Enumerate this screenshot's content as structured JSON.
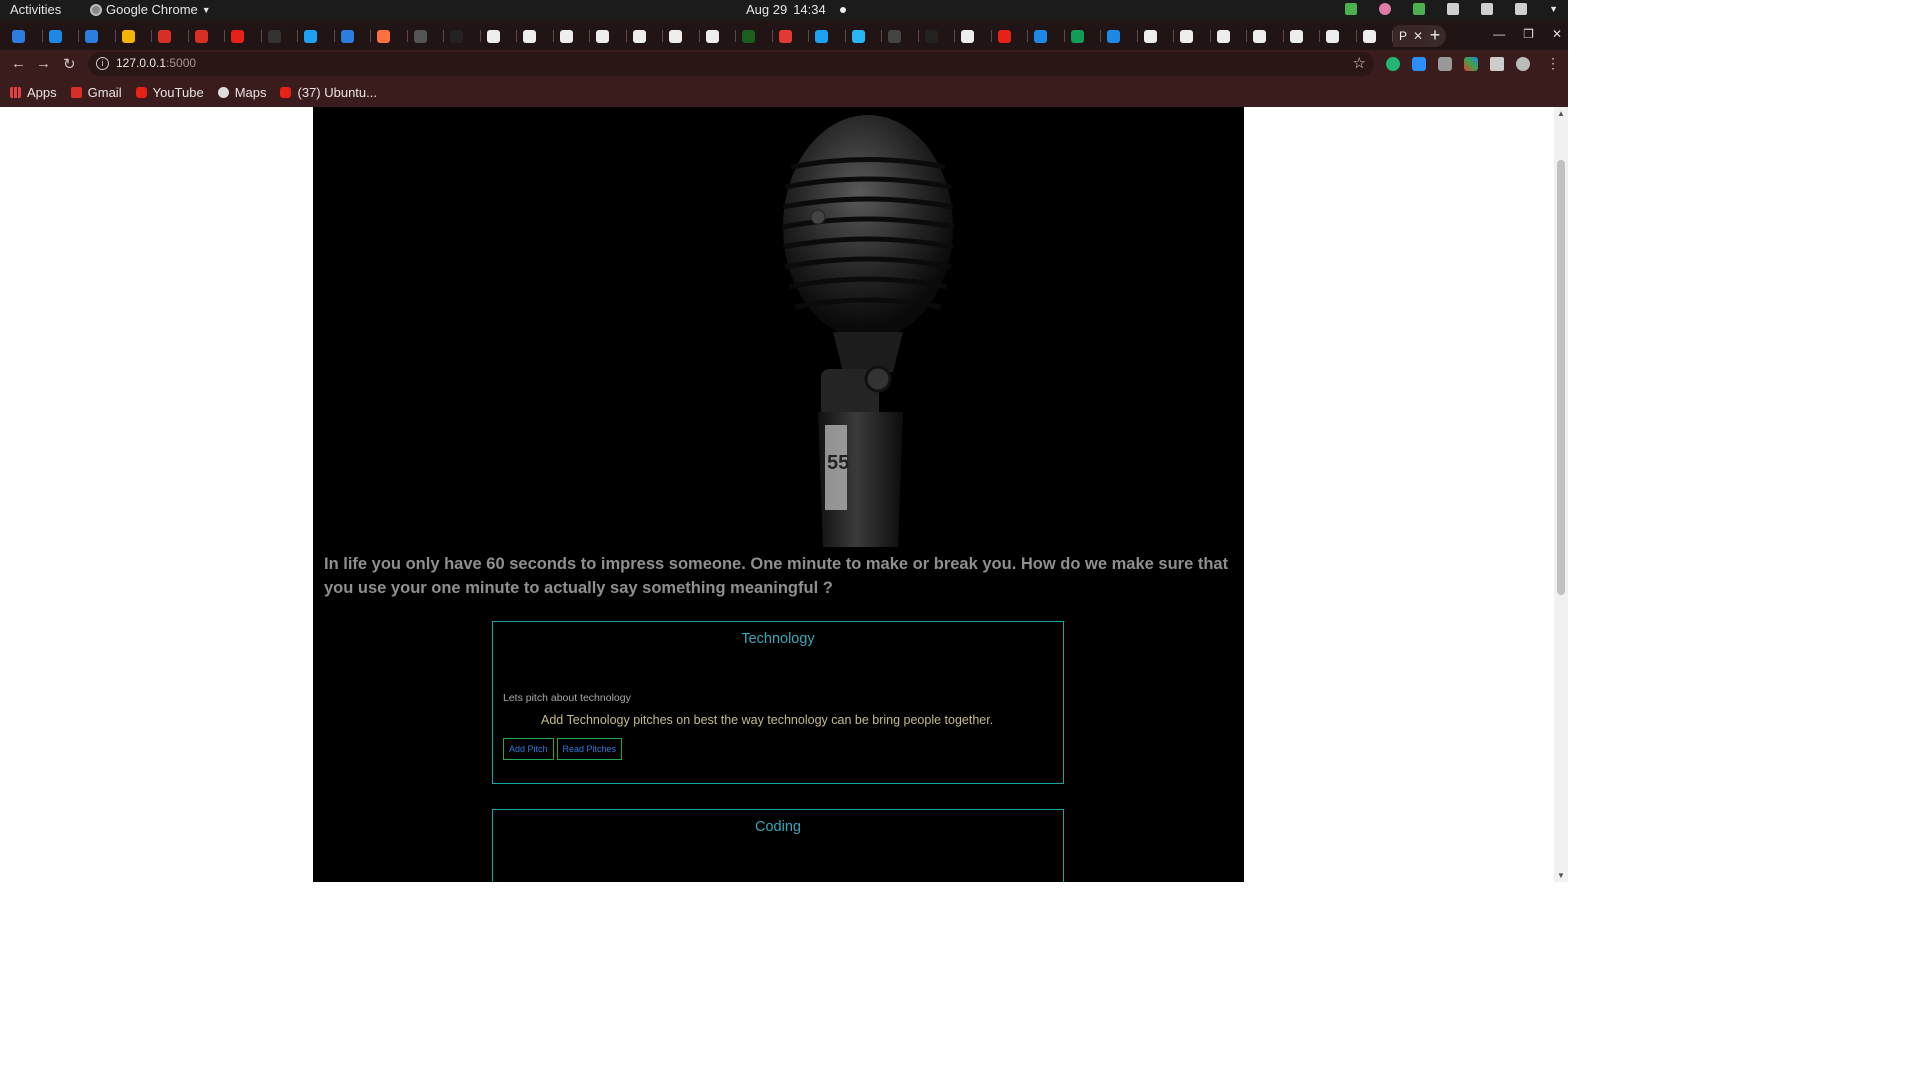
{
  "system_bar": {
    "activities": "Activities",
    "app_name": "Google Chrome",
    "date": "Aug 29",
    "time": "14:34"
  },
  "browser": {
    "active_tab_letter": "P",
    "url_host": "127.0.0.1",
    "url_port": ":5000",
    "bookmarks": [
      "Apps",
      "Gmail",
      "YouTube",
      "Maps",
      "(37) Ubuntu..."
    ]
  },
  "page": {
    "tagline": "In life you only have 60 seconds to impress someone. One minute to make or break you. How do we make sure that you use your one minute to actually say something meaningful ?",
    "categories": [
      {
        "title": "Technology",
        "subtitle": "Lets pitch about technology",
        "description": "Add Technology pitches on best the way technology can be bring people together.",
        "add_label": "Add Pitch",
        "read_label": "Read Pitches"
      },
      {
        "title": "Coding"
      }
    ]
  }
}
